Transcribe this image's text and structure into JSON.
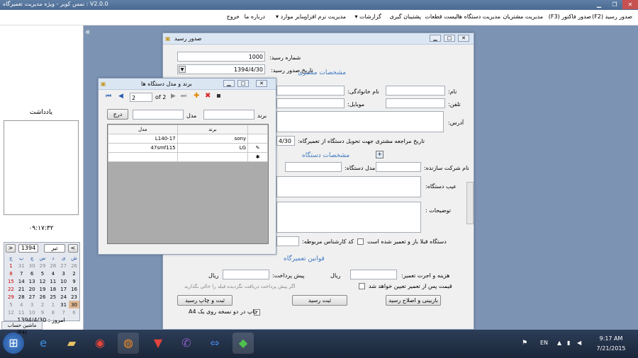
{
  "app": {
    "title": "نمس کویر - ویژه مدیریت تعمیرگاه : V2.0.0"
  },
  "menu": [
    {
      "label": "صدور رسید (F2)"
    },
    {
      "label": "صدور فاکتور (F3)"
    },
    {
      "label": "مدیریت مشتریان"
    },
    {
      "label": "مدیریت دستگاه ها"
    },
    {
      "label": "لیست قطعات"
    },
    {
      "label": "پشتیبان گیری"
    },
    {
      "label": "گزارشات ▾"
    },
    {
      "label": "مدیریت نرم افزار"
    },
    {
      "label": "سایر موارد ▾"
    },
    {
      "label": "درباره ما"
    },
    {
      "label": "خروج"
    }
  ],
  "sidebar": {
    "notes_title": "یادداشت",
    "clock": "۰۹:۱۷:۳۲",
    "cal_year": "1394",
    "cal_month": "تیر",
    "cal_prev": "<",
    "cal_next": ">",
    "weekdays": [
      "ش",
      "ی",
      "د",
      "س",
      "چ",
      "پ",
      "ج"
    ],
    "weeks": [
      [
        "26",
        "27",
        "28",
        "29",
        "30",
        "31",
        "1"
      ],
      [
        "2",
        "3",
        "4",
        "5",
        "6",
        "7",
        "8"
      ],
      [
        "9",
        "10",
        "11",
        "12",
        "13",
        "14",
        "15"
      ],
      [
        "16",
        "17",
        "18",
        "19",
        "20",
        "21",
        "22"
      ],
      [
        "23",
        "24",
        "25",
        "26",
        "27",
        "28",
        "29"
      ],
      [
        "30",
        "31",
        "1",
        "2",
        "3",
        "4",
        "5"
      ],
      [
        "6",
        "7",
        "8",
        "9",
        "10",
        "11",
        "12"
      ]
    ],
    "today": "امروز : 1394/4/30",
    "status_footer": "ماشین حساب (F4)"
  },
  "receipt": {
    "title": "صدور رسید",
    "no_label": "شماره رسید:",
    "no_value": "1000",
    "date_label": "تاریخ صدور رسید:",
    "date_value": "1394/4/30",
    "customer_section": "مشخصات مشتری",
    "name_label": "نام:",
    "family_label": "نام خانوادگی:",
    "phone_label": "تلفن:",
    "mobile_label": "موبایل:",
    "address_label": "آدرس:",
    "return_date_label": "تاریخ مراجعه مشتری جهت تحویل دستگاه از تعمیرگاه:",
    "return_date_value": "4/30",
    "device_section": "مشخصات دستگاه",
    "maker_label": "نام شرکت سازنده:",
    "model_label": "مدل دستگاه:",
    "defect_label": "عیب دستگاه:",
    "desc_label": "توضیحات :",
    "prev_repair_label": "دستگاه قبلا باز و تعمیر شده است",
    "tech_label": "کد کارشناس مربوطه:",
    "rules_section": "قوانین تعمیرگاه",
    "cost_label": "هزینه و اجرت تعمیر:",
    "rial1": "ریال",
    "prepay_label": "پیش پرداخت:",
    "rial2": "ریال",
    "price_after_label": "قیمت پس از تعمیر تعیین خواهد شد",
    "prepay_hint": "اگر پیش پرداخت دریافت نگردیده فیلد را خالی بگذارید",
    "btn_inspect": "بازبینی و اصلاح رسید",
    "btn_save": "ثبت رسید",
    "btn_save_print": "ثبت و چاپ رسید",
    "print_a4_label": "چاپ در دو نسخه روی یک A4"
  },
  "brand": {
    "title": "برند و مدل دستگاه ها",
    "nav_pos": "2",
    "nav_total": "of 2",
    "brand_label": "برند",
    "model_label": "مدل",
    "insert_btn": "درج",
    "col_brand": "برند",
    "col_model": "مدل",
    "rows": [
      {
        "brand": "sony",
        "model": "L140-17"
      },
      {
        "brand": "LG",
        "model": "47smf115"
      }
    ]
  },
  "taskbar": {
    "lang": "EN",
    "time": "9:17 AM",
    "date": "7/21/2015"
  }
}
